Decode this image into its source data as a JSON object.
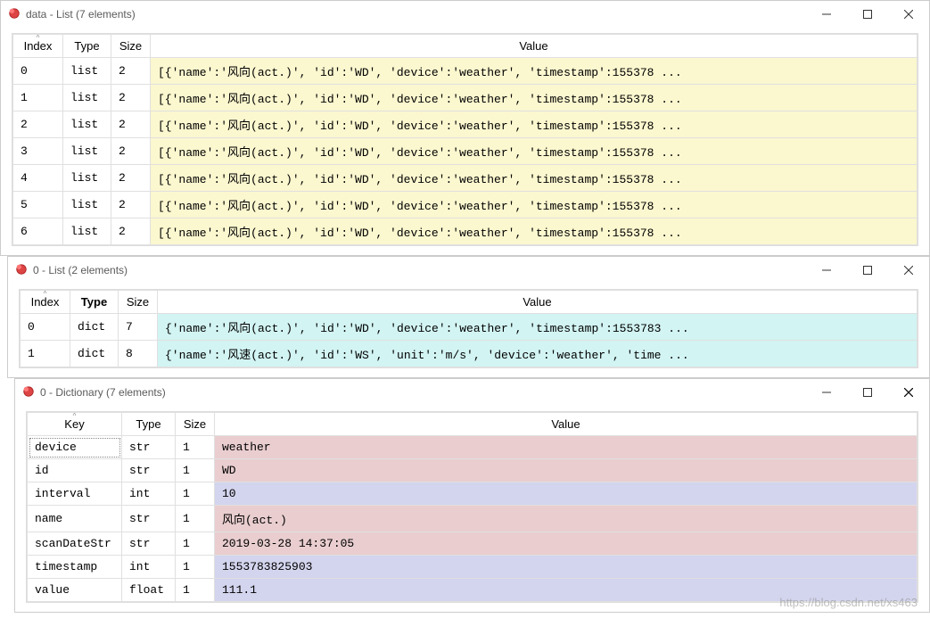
{
  "watermark": "https://blog.csdn.net/xs463",
  "win1": {
    "title": "data - List (7 elements)",
    "headers": {
      "index": "Index",
      "type": "Type",
      "size": "Size",
      "value": "Value"
    },
    "rows": [
      {
        "index": "0",
        "type": "list",
        "size": "2",
        "value": "[{'name':'风向(act.)', 'id':'WD', 'device':'weather', 'timestamp':155378 ..."
      },
      {
        "index": "1",
        "type": "list",
        "size": "2",
        "value": "[{'name':'风向(act.)', 'id':'WD', 'device':'weather', 'timestamp':155378 ..."
      },
      {
        "index": "2",
        "type": "list",
        "size": "2",
        "value": "[{'name':'风向(act.)', 'id':'WD', 'device':'weather', 'timestamp':155378 ..."
      },
      {
        "index": "3",
        "type": "list",
        "size": "2",
        "value": "[{'name':'风向(act.)', 'id':'WD', 'device':'weather', 'timestamp':155378 ..."
      },
      {
        "index": "4",
        "type": "list",
        "size": "2",
        "value": "[{'name':'风向(act.)', 'id':'WD', 'device':'weather', 'timestamp':155378 ..."
      },
      {
        "index": "5",
        "type": "list",
        "size": "2",
        "value": "[{'name':'风向(act.)', 'id':'WD', 'device':'weather', 'timestamp':155378 ..."
      },
      {
        "index": "6",
        "type": "list",
        "size": "2",
        "value": "[{'name':'风向(act.)', 'id':'WD', 'device':'weather', 'timestamp':155378 ..."
      }
    ]
  },
  "win2": {
    "title": "0 - List (2 elements)",
    "headers": {
      "index": "Index",
      "type": "Type",
      "size": "Size",
      "value": "Value"
    },
    "rows": [
      {
        "index": "0",
        "type": "dict",
        "size": "7",
        "value": "{'name':'风向(act.)', 'id':'WD', 'device':'weather', 'timestamp':1553783 ..."
      },
      {
        "index": "1",
        "type": "dict",
        "size": "8",
        "value": "{'name':'风速(act.)', 'id':'WS', 'unit':'m/s', 'device':'weather', 'time ..."
      }
    ]
  },
  "win3": {
    "title": "0 - Dictionary (7 elements)",
    "headers": {
      "key": "Key",
      "type": "Type",
      "size": "Size",
      "value": "Value"
    },
    "rows": [
      {
        "key": "device",
        "type": "str",
        "size": "1",
        "value": "weather",
        "cls": "pink"
      },
      {
        "key": "id",
        "type": "str",
        "size": "1",
        "value": "WD",
        "cls": "pink"
      },
      {
        "key": "interval",
        "type": "int",
        "size": "1",
        "value": "10",
        "cls": "blue"
      },
      {
        "key": "name",
        "type": "str",
        "size": "1",
        "value": "风向(act.)",
        "cls": "pink"
      },
      {
        "key": "scanDateStr",
        "type": "str",
        "size": "1",
        "value": "2019-03-28 14:37:05",
        "cls": "pink"
      },
      {
        "key": "timestamp",
        "type": "int",
        "size": "1",
        "value": "1553783825903",
        "cls": "blue"
      },
      {
        "key": "value",
        "type": "float",
        "size": "1",
        "value": "111.1",
        "cls": "blue"
      }
    ]
  }
}
